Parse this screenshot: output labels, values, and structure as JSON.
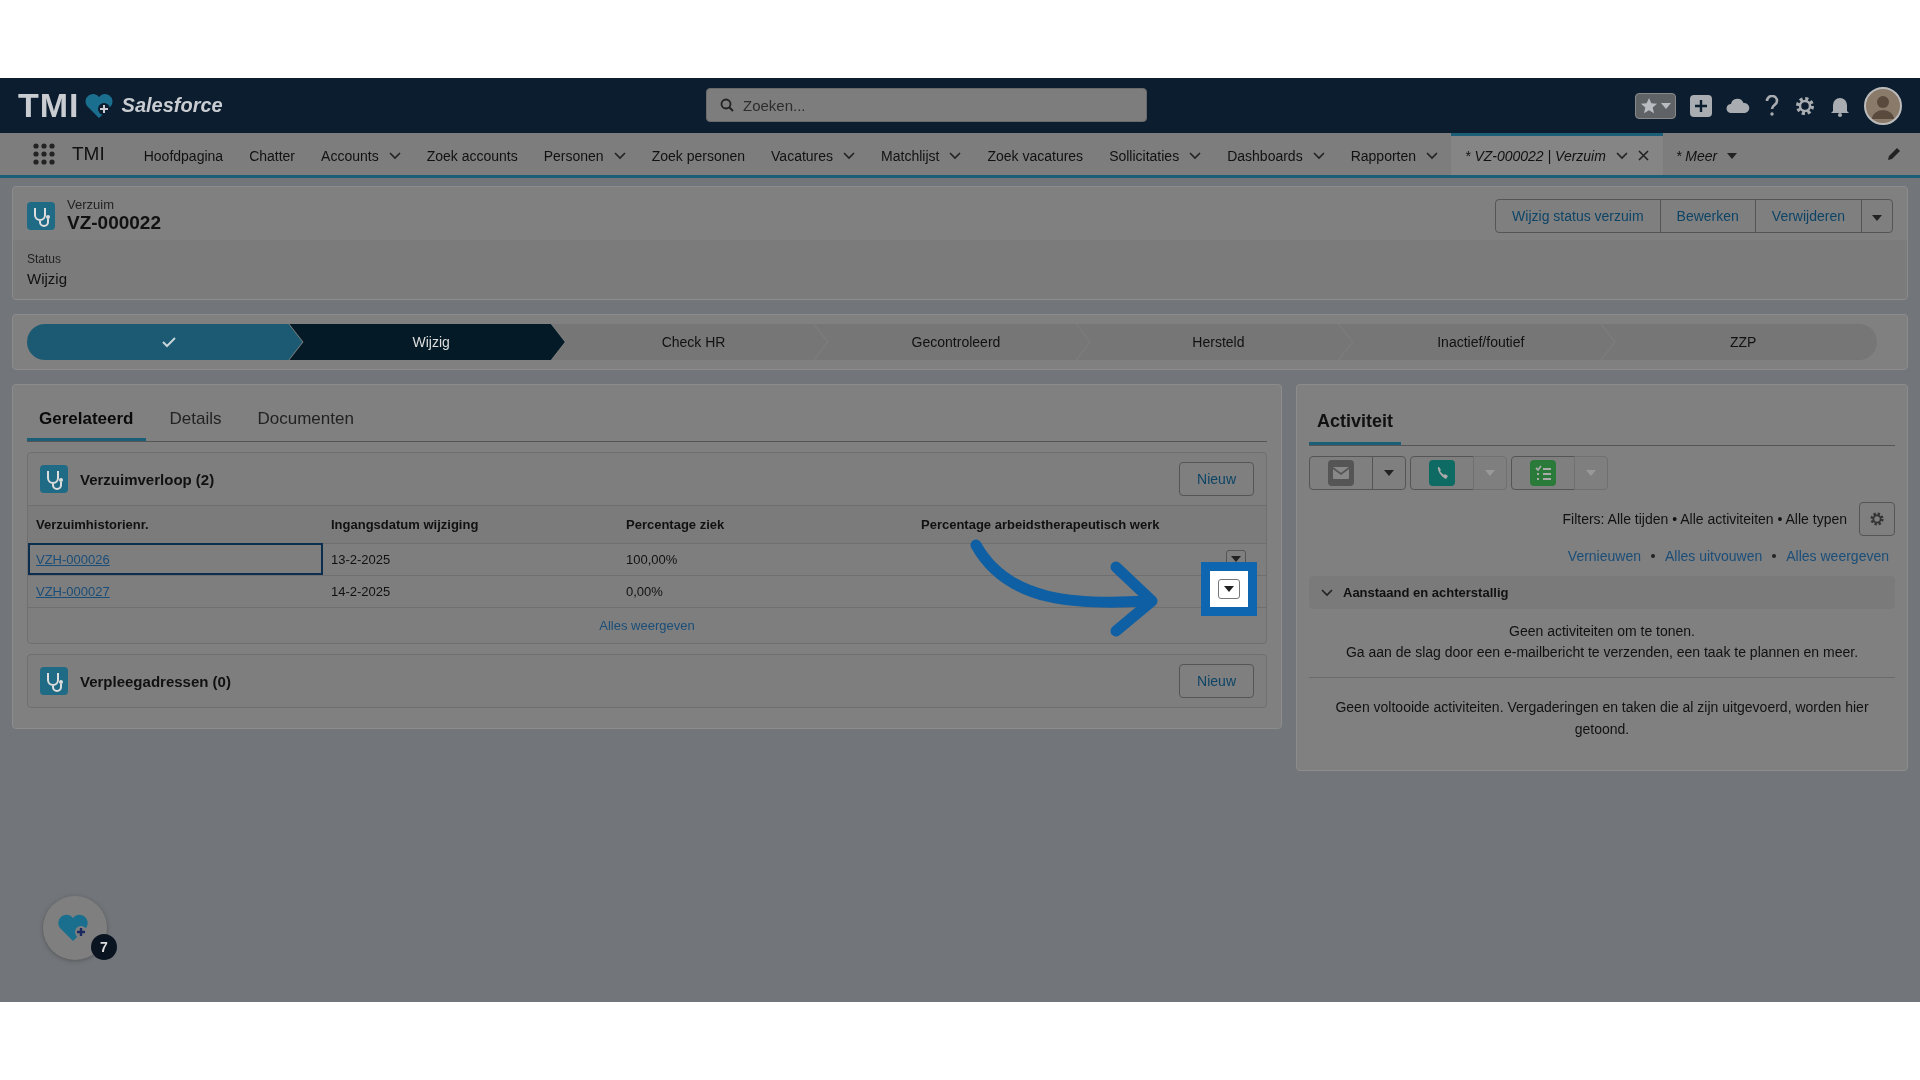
{
  "header": {
    "brand": "TMI",
    "product": "Salesforce",
    "search": {
      "placeholder": "Zoeken..."
    }
  },
  "nav": {
    "app_name": "TMI",
    "items": [
      {
        "label": "Hoofdpagina",
        "kind": "link",
        "dropdown": false,
        "selected": false
      },
      {
        "label": "Chatter",
        "kind": "link",
        "dropdown": false,
        "selected": false
      },
      {
        "label": "Accounts",
        "kind": "link",
        "dropdown": true,
        "selected": false
      },
      {
        "label": "Zoek accounts",
        "kind": "link",
        "dropdown": false,
        "selected": false
      },
      {
        "label": "Personen",
        "kind": "link",
        "dropdown": true,
        "selected": false
      },
      {
        "label": "Zoek personen",
        "kind": "link",
        "dropdown": false,
        "selected": false
      },
      {
        "label": "Vacatures",
        "kind": "link",
        "dropdown": true,
        "selected": false
      },
      {
        "label": "Matchlijst",
        "kind": "link",
        "dropdown": true,
        "selected": false
      },
      {
        "label": "Zoek vacatures",
        "kind": "link",
        "dropdown": false,
        "selected": false
      },
      {
        "label": "Sollicitaties",
        "kind": "link",
        "dropdown": true,
        "selected": false
      },
      {
        "label": "Dashboards",
        "kind": "link",
        "dropdown": true,
        "selected": false
      },
      {
        "label": "Rapporten",
        "kind": "link",
        "dropdown": true,
        "selected": false
      },
      {
        "label": "* VZ-000022 | Verzuim",
        "kind": "record",
        "dropdown": true,
        "selected": true
      },
      {
        "label": "* Meer",
        "kind": "more",
        "dropdown": true,
        "selected": false
      }
    ]
  },
  "record": {
    "object": "Verzuim",
    "name": "VZ-000022",
    "actions": [
      "Wijzig status verzuim",
      "Bewerken",
      "Verwijderen"
    ],
    "fields": [
      {
        "label": "Status",
        "value": "Wijzig"
      }
    ]
  },
  "path": {
    "stages": [
      {
        "complete": true,
        "current": false
      },
      {
        "label": "Wijzig",
        "complete": false,
        "current": true
      },
      {
        "label": "Check HR",
        "complete": false,
        "current": false
      },
      {
        "label": "Gecontroleerd",
        "complete": false,
        "current": false
      },
      {
        "label": "Hersteld",
        "complete": false,
        "current": false
      },
      {
        "label": "Inactief/foutief",
        "complete": false,
        "current": false
      },
      {
        "label": "ZZP",
        "complete": false,
        "current": false
      }
    ]
  },
  "tabs": [
    {
      "label": "Gerelateerd",
      "selected": true
    },
    {
      "label": "Details",
      "selected": false
    },
    {
      "label": "Documenten",
      "selected": false
    }
  ],
  "related_lists": [
    {
      "title": "Verzuimverloop (2)",
      "button": "Nieuw",
      "columns": [
        "Verzuimhistorienr.",
        "Ingangsdatum wijziging",
        "Percentage ziek",
        "Percentage arbeidstherapeutisch werk"
      ],
      "rows": [
        {
          "cells": [
            "VZH-000026",
            "13-2-2025",
            "100,00%"
          ],
          "focused": true,
          "menu_highlighted": false
        },
        {
          "cells": [
            "VZH-000027",
            "14-2-2025",
            "0,00%"
          ],
          "focused": false,
          "menu_highlighted": true
        }
      ],
      "footer_link": "Alles weergeven"
    },
    {
      "title": "Verpleegadressen (0)",
      "button": "Nieuw"
    }
  ],
  "activity": {
    "tab": "Activiteit",
    "actions": [
      {
        "kind": "email",
        "dropdown_disabled": false
      },
      {
        "kind": "call",
        "dropdown_disabled": true
      },
      {
        "kind": "task",
        "dropdown_disabled": true
      }
    ],
    "filters": "Filters: Alle tijden • Alle activiteiten • Alle typen",
    "links": [
      "Vernieuwen",
      "Alles uitvouwen",
      "Alles weergeven"
    ],
    "section": {
      "title": "Aanstaand en achterstallig",
      "expanded": true,
      "messages": [
        "Geen activiteiten om te tonen.",
        "Ga aan de slag door een e-mailbericht te verzenden, een taak te plannen en meer."
      ]
    },
    "past_message": "Geen voltooide activiteiten. Vergaderingen en taken die al zijn uitgevoerd, worden hier getoond."
  },
  "utility": {
    "badge": "7"
  }
}
